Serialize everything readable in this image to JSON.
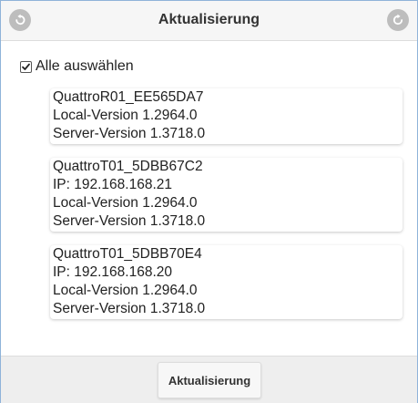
{
  "header": {
    "title": "Aktualisierung",
    "back_icon": "back-arrow-icon",
    "refresh_icon": "refresh-icon"
  },
  "select_all": {
    "label": "Alle auswählen",
    "checked": true
  },
  "devices": [
    {
      "name": "QuattroR01_EE565DA7",
      "lines": [
        "Local-Version 1.2964.0",
        "Server-Version 1.3718.0"
      ]
    },
    {
      "name": "QuattroT01_5DBB67C2",
      "lines": [
        "IP: 192.168.168.21",
        "Local-Version 1.2964.0",
        "Server-Version 1.3718.0"
      ]
    },
    {
      "name": "QuattroT01_5DBB70E4",
      "lines": [
        "IP: 192.168.168.20",
        "Local-Version 1.2964.0",
        "Server-Version 1.3718.0"
      ]
    }
  ],
  "footer": {
    "update_label": "Aktualisierung"
  },
  "colors": {
    "window_border": "#8fb3d9",
    "header_bg": "#f6f6f6",
    "icon_bg": "#bdbdbd",
    "footer_bg": "#eeeeee"
  }
}
